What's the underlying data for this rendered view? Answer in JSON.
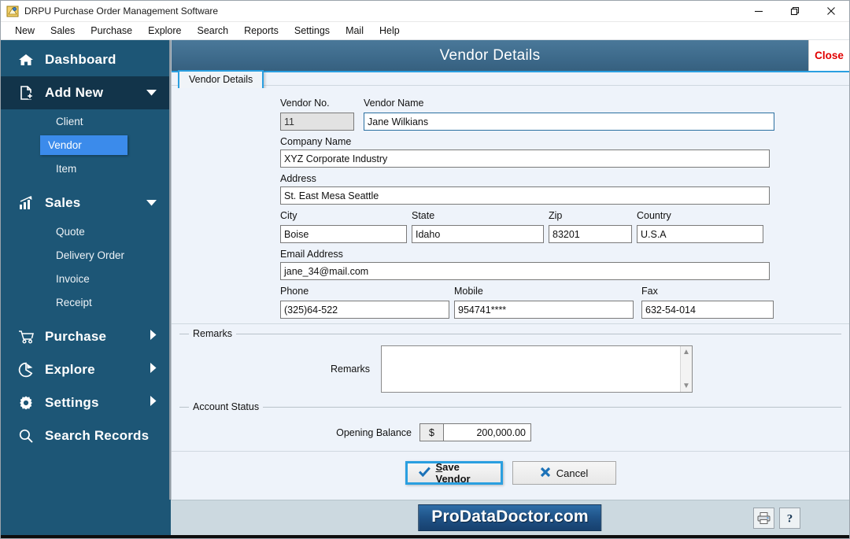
{
  "window": {
    "title": "DRPU Purchase Order Management Software",
    "app_icon": "app-logo-icon",
    "minimize": "minimize-icon",
    "maximize": "maximize-icon",
    "close": "close-icon"
  },
  "menubar": {
    "items": [
      "New",
      "Sales",
      "Purchase",
      "Explore",
      "Search",
      "Reports",
      "Settings",
      "Mail",
      "Help"
    ]
  },
  "sidebar": {
    "bg_color": "#1d5676",
    "active_bg_color": "#12344a",
    "selected_color": "#3b8beb",
    "groups": [
      {
        "label": "Dashboard",
        "icon": "home-icon",
        "expanded": false,
        "chevron": "",
        "active": false
      },
      {
        "label": "Add New",
        "icon": "document-plus-icon",
        "expanded": true,
        "chevron": "down",
        "active": true,
        "children": [
          {
            "label": "Client",
            "selected": false
          },
          {
            "label": "Vendor",
            "selected": true
          },
          {
            "label": "Item",
            "selected": false
          }
        ]
      },
      {
        "label": "Sales",
        "icon": "chart-up-icon",
        "expanded": true,
        "chevron": "down",
        "active": false,
        "children": [
          {
            "label": "Quote",
            "selected": false
          },
          {
            "label": "Delivery Order",
            "selected": false
          },
          {
            "label": "Invoice",
            "selected": false
          },
          {
            "label": "Receipt",
            "selected": false
          }
        ]
      },
      {
        "label": "Purchase",
        "icon": "cart-icon",
        "expanded": false,
        "chevron": "right",
        "active": false
      },
      {
        "label": "Explore",
        "icon": "pie-chart-icon",
        "expanded": false,
        "chevron": "right",
        "active": false
      },
      {
        "label": "Settings",
        "icon": "gear-icon",
        "expanded": false,
        "chevron": "right",
        "active": false
      },
      {
        "label": "Search Records",
        "icon": "search-icon",
        "expanded": false,
        "chevron": "",
        "active": false
      }
    ]
  },
  "form": {
    "header_title": "Vendor Details",
    "close_label": "Close",
    "tab_label": "Vendor Details",
    "fields": {
      "vendor_no_label": "Vendor No.",
      "vendor_no_value": "11",
      "vendor_name_label": "Vendor Name",
      "vendor_name_value": "Jane Wilkians",
      "company_name_label": "Company Name",
      "company_name_value": "XYZ Corporate Industry",
      "address_label": "Address",
      "address_value": "St. East Mesa Seattle",
      "city_label": "City",
      "city_value": "Boise",
      "state_label": "State",
      "state_value": "Idaho",
      "zip_label": "Zip",
      "zip_value": "83201",
      "country_label": "Country",
      "country_value": "U.S.A",
      "email_label": "Email Address",
      "email_value": "jane_34@mail.com",
      "phone_label": "Phone",
      "phone_value": "(325)64-522",
      "mobile_label": "Mobile",
      "mobile_value": "954741****",
      "fax_label": "Fax",
      "fax_value": "632-54-014"
    },
    "remarks_group": {
      "title": "Remarks",
      "field_label": "Remarks",
      "value": "",
      "scroll_up_icon": "chevron-up-icon",
      "scroll_down_icon": "chevron-down-icon"
    },
    "account_status_group": {
      "title": "Account Status",
      "opening_balance_label": "Opening Balance",
      "currency_symbol": "$",
      "opening_balance_value": "200,000.00"
    },
    "buttons": {
      "save_accel": "S",
      "save_rest": "ave Vendor",
      "save_icon": "check-icon",
      "cancel_label": "Cancel",
      "cancel_icon": "x-icon"
    }
  },
  "footer": {
    "brand": "ProDataDoctor.com",
    "print_icon": "printer-icon",
    "help_icon": "help-icon"
  }
}
